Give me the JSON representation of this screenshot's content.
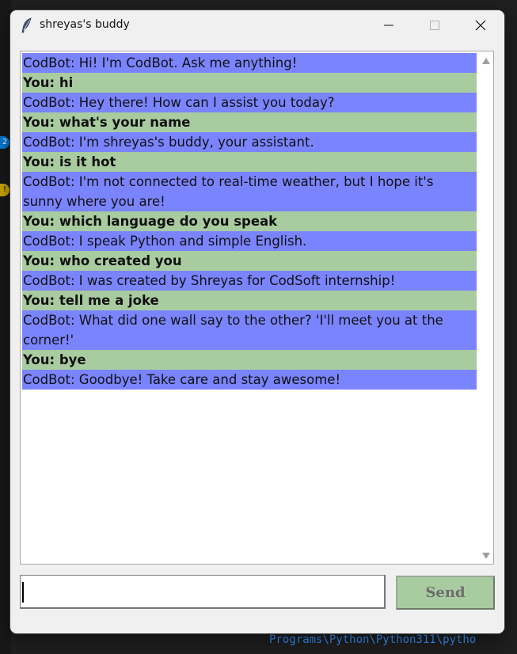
{
  "window": {
    "title": "shreyas's buddy",
    "icon": "feather-icon"
  },
  "chat": {
    "messages": [
      {
        "sender": "bot",
        "text": "CodBot: Hi! I'm CodBot. Ask me anything!"
      },
      {
        "sender": "user",
        "text": "You: hi"
      },
      {
        "sender": "bot",
        "text": "CodBot: Hey there! How can I assist you today?"
      },
      {
        "sender": "user",
        "text": "You: what's your name"
      },
      {
        "sender": "bot",
        "text": "CodBot: I'm shreyas's buddy, your assistant."
      },
      {
        "sender": "user",
        "text": "You: is it hot"
      },
      {
        "sender": "bot",
        "text": "CodBot: I'm not connected to real-time weather, but I hope it's sunny where you are!"
      },
      {
        "sender": "user",
        "text": "You: which language do you speak"
      },
      {
        "sender": "bot",
        "text": "CodBot: I speak Python  and simple English."
      },
      {
        "sender": "user",
        "text": "You: who created you"
      },
      {
        "sender": "bot",
        "text": "CodBot: I was created by Shreyas for CodSoft internship!"
      },
      {
        "sender": "user",
        "text": "You: tell me a joke"
      },
      {
        "sender": "bot",
        "text": "CodBot: What did one wall say to the other? 'I'll meet you at the corner!'"
      },
      {
        "sender": "user",
        "text": "You: bye"
      },
      {
        "sender": "bot",
        "text": "CodBot: Goodbye! Take care and stay awesome!"
      }
    ]
  },
  "input": {
    "value": ""
  },
  "send_button": {
    "label": "Send"
  },
  "colors": {
    "bot_bg": "#7b84ff",
    "user_bg": "#a9cba0"
  },
  "background": {
    "badge_blue": "2",
    "terminal_line": "Programs\\Python\\Python311\\pytho"
  }
}
